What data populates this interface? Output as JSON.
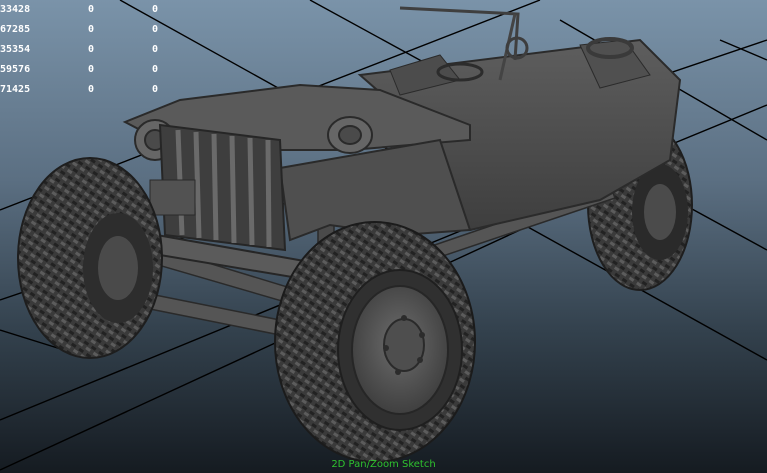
{
  "hud": {
    "rows": [
      {
        "id": "33428",
        "v1": "0",
        "v2": "0"
      },
      {
        "id": "67285",
        "v1": "0",
        "v2": "0"
      },
      {
        "id": "35354",
        "v1": "0",
        "v2": "0"
      },
      {
        "id": "59576",
        "v1": "0",
        "v2": "0"
      },
      {
        "id": "71425",
        "v1": "0",
        "v2": "0"
      }
    ]
  },
  "viewport": {
    "mode_label": "2D Pan/Zoom Sketch",
    "colors": {
      "background_top": "#7a93a9",
      "background_bottom": "#151b21",
      "grid": "#000000",
      "mesh": "#4a4a4a",
      "mode_label": "#2ec22e"
    }
  }
}
